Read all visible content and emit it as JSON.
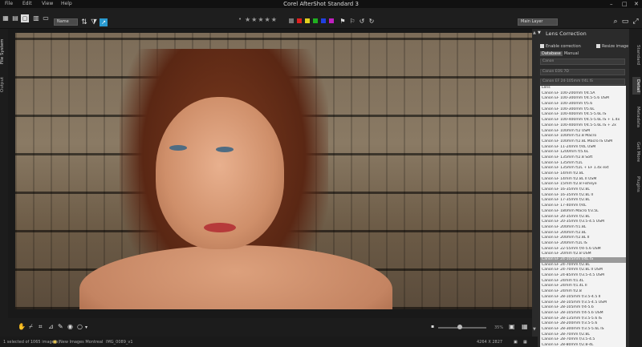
{
  "titlebar": {
    "title": "Corel AfterShot Standard 3",
    "menus": [
      "File",
      "Edit",
      "View",
      "Help"
    ]
  },
  "toolbar": {
    "sort_select": "Name",
    "mode_select": "Main Layer",
    "rating_stars": "★★★★★",
    "color_labels": [
      "#777777",
      "#e02020",
      "#e0d020",
      "#20b020",
      "#2040e0",
      "#c020c0"
    ]
  },
  "left_tabs": [
    "File System",
    "Output"
  ],
  "right_tabs": [
    "Standard",
    "Detail",
    "Metadata",
    "Get More",
    "Plugins"
  ],
  "viewer": {
    "zoom": "35%"
  },
  "panel": {
    "title": "Lens Correction",
    "enable_correction": "Enable correction",
    "resize_image": "Resize image",
    "tabs": [
      "Database",
      "Manual"
    ],
    "camera_make": "Canon",
    "camera_model": "Canon EOS 7D",
    "lens_select": "Canon EF 24-105mm f/4L IS",
    "lens_list": [
      "Lens",
      "Canon EF 100-200mm f/4.5A",
      "Canon EF 100-300mm f/4.5-5.6 USM",
      "Canon EF 100-300mm f/5.6",
      "Canon EF 100-300mm f/5.6L",
      "Canon EF 100-400mm f/4.5-5.6L IS",
      "Canon EF 100-400mm f/4.5-5.6L IS + 1.4x",
      "Canon EF 100-400mm f/4.5-5.6L IS + 2x",
      "Canon EF 100mm f/2 USM",
      "Canon EF 100mm f/2.8 Macro",
      "Canon EF 100mm f/2.8L Macro IS USM",
      "Canon EF 11-24mm f/4L USM",
      "Canon EF 1200mm f/5.6L",
      "Canon EF 135mm f/2.8 Soft",
      "Canon EF 135mm f/2L",
      "Canon EF 135mm f/2L + EF 1.4x ext",
      "Canon EF 14mm f/2.8L",
      "Canon EF 14mm f/2.8L II USM",
      "Canon EF 15mm f/2.8 Fisheye",
      "Canon EF 16-35mm f/2.8L",
      "Canon EF 16-35mm f/2.8L II",
      "Canon EF 17-35mm f/2.8L",
      "Canon EF 17-40mm f/4L",
      "Canon EF 180mm Macro f/3.5L",
      "Canon EF 20-35mm f/2.8L",
      "Canon EF 20-35mm f/3.5-4.5 USM",
      "Canon EF 200mm f/1.8L",
      "Canon EF 200mm f/2.8L",
      "Canon EF 200mm f/2.8L II",
      "Canon EF 200mm f/2L IS",
      "Canon EF 22-55mm f/4-5.6 USM",
      "Canon EF 20mm f/2.8 USM",
      "Canon EF 24-105mm f/4L IS",
      "Canon EF 24-70mm f/2.8L",
      "Canon EF 24-70mm f/2.8L II USM",
      "Canon EF 24-85mm f/3.5-4.5 USM",
      "Canon EF 24mm f/1.4L",
      "Canon EF 24mm f/1.4L II",
      "Canon EF 24mm f/2.8",
      "Canon EF 28-105mm f/3.5-4.5 II",
      "Canon EF 28-105mm f/3.5-4.5 USM",
      "Canon EF 28-105mm f/4-5.6",
      "Canon EF 28-105mm f/4-5.6 USM",
      "Canon EF 28-135mm f/3.5-5.6 IS",
      "Canon EF 28-200mm f/3.5-5.6",
      "Canon EF 28-300mm f/3.5-5.6L IS",
      "Canon EF 28-70mm f/2.8L",
      "Canon EF 28-70mm f/3.5-4.5",
      "Canon EF 28-80mm f/2.8-4L",
      "Canon EF 28-80mm f/3.5-5.6",
      "Canon EF 28-80mm f/3.5-5.6 USM"
    ],
    "selected_index": 32
  },
  "statusbar": {
    "selected": "1 selected of 1065 image(s)",
    "folder": "New Images Montreal",
    "filename": "IMG_0089_v1",
    "dimensions": "4264 X 2827"
  }
}
